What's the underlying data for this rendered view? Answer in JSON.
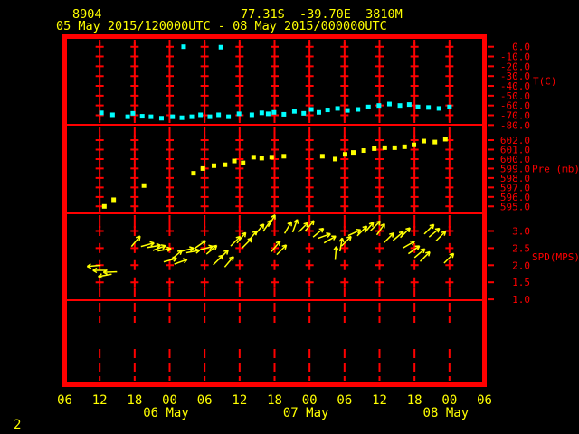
{
  "header": {
    "station_id": "8904",
    "location": "77.31S  -39.70E  3810M",
    "period": "05 May 2015/120000UTC - 08 May 2015/000000UTC"
  },
  "page_number": "2",
  "colors": {
    "background": "#000000",
    "grid": "#ff0000",
    "axis_text": "#ff0000",
    "text": "#ffff00",
    "temperature": "#00ffff",
    "pressure": "#ffff00",
    "wind": "#ffff00"
  },
  "chart_data": {
    "type": "scatter",
    "title": "Buoy 8904 time series 05 May 2015 12UTC - 08 May 2015 00UTC",
    "x_axis": {
      "tick_labels": [
        "06",
        "12",
        "18",
        "00",
        "06",
        "12",
        "18",
        "00",
        "06",
        "12",
        "18",
        "00",
        "06"
      ],
      "tick_interval_hours": 6,
      "hours_span": 72,
      "date_labels": [
        {
          "label": "06 May",
          "tick_index": 3
        },
        {
          "label": "07 May",
          "tick_index": 7
        },
        {
          "label": "08 May",
          "tick_index": 11
        }
      ]
    },
    "panels": [
      {
        "name": "temperature",
        "axis_label": "T(C)",
        "unit": "C",
        "level_labels": [
          "0.0",
          "-10.0",
          "-20.0",
          "-30.0",
          "-40.0",
          "-50.0",
          "-60.0",
          "-70.0",
          "-80.0"
        ],
        "value_top": 0,
        "value_step": -10,
        "series": [
          [
            6.3,
            -67.5
          ],
          [
            8.2,
            -69.5
          ],
          [
            10.8,
            -71.5
          ],
          [
            11.7,
            -68
          ],
          [
            13.3,
            -71
          ],
          [
            14.8,
            -71.5
          ],
          [
            16.6,
            -73
          ],
          [
            18.5,
            -71.5
          ],
          [
            20.1,
            -72.5
          ],
          [
            20.4,
            0
          ],
          [
            21.8,
            -71.5
          ],
          [
            23.3,
            -69.5
          ],
          [
            24.9,
            -71.5
          ],
          [
            26.4,
            -69.5
          ],
          [
            26.8,
            -0.5
          ],
          [
            28.1,
            -71.5
          ],
          [
            29.9,
            -68.5
          ],
          [
            32.1,
            -69.5
          ],
          [
            33.8,
            -67.5
          ],
          [
            34.9,
            -68.5
          ],
          [
            35.9,
            -67
          ],
          [
            37.6,
            -69
          ],
          [
            39.4,
            -66
          ],
          [
            41,
            -68
          ],
          [
            42.3,
            -64
          ],
          [
            43.6,
            -67
          ],
          [
            45.1,
            -64.5
          ],
          [
            46.8,
            -63
          ],
          [
            48.5,
            -65
          ],
          [
            50.3,
            -64
          ],
          [
            52.1,
            -61.5
          ],
          [
            53.9,
            -60
          ],
          [
            55.7,
            -58.5
          ],
          [
            57.5,
            -60
          ],
          [
            59.1,
            -59
          ],
          [
            60.6,
            -61.5
          ],
          [
            62.4,
            -62
          ],
          [
            64.2,
            -63
          ],
          [
            66,
            -61.5
          ]
        ]
      },
      {
        "name": "pressure",
        "axis_label": "Pre (mb)",
        "unit": "mb",
        "level_labels": [
          "602.0",
          "601.0",
          "600.0",
          "599.0",
          "598.0",
          "597.0",
          "596.0",
          "595.0"
        ],
        "value_top": 602,
        "value_step": -1,
        "series": [
          [
            6.8,
            595.0
          ],
          [
            8.4,
            595.7
          ],
          [
            13.6,
            597.2
          ],
          [
            22.1,
            598.5
          ],
          [
            23.7,
            599.0
          ],
          [
            25.6,
            599.3
          ],
          [
            27.5,
            599.4
          ],
          [
            29.1,
            599.8
          ],
          [
            30.6,
            599.6
          ],
          [
            32.4,
            600.2
          ],
          [
            33.8,
            600.1
          ],
          [
            35.5,
            600.2
          ],
          [
            37.6,
            600.3
          ],
          [
            44.2,
            600.3
          ],
          [
            46.4,
            600.0
          ],
          [
            48.1,
            600.5
          ],
          [
            49.5,
            600.7
          ],
          [
            51.3,
            600.9
          ],
          [
            53.1,
            601.1
          ],
          [
            54.9,
            601.2
          ],
          [
            56.6,
            601.2
          ],
          [
            58.3,
            601.3
          ],
          [
            59.9,
            601.5
          ],
          [
            61.6,
            601.9
          ],
          [
            63.5,
            601.8
          ],
          [
            65.3,
            602.1
          ]
        ]
      },
      {
        "name": "wind_speed",
        "axis_label": "SPD(MPS)",
        "unit": "MPS",
        "level_labels": [
          "3.0",
          "2.5",
          "2.0",
          "1.5",
          "1.0"
        ],
        "value_top": 3.0,
        "value_step": -0.5,
        "arrows": [
          [
            5.0,
            1.98,
            185
          ],
          [
            6.0,
            1.85,
            180
          ],
          [
            6.9,
            1.7,
            190
          ],
          [
            7.8,
            1.8,
            182
          ],
          [
            12.2,
            2.7,
            50
          ],
          [
            14.2,
            2.6,
            15
          ],
          [
            15.3,
            2.55,
            10
          ],
          [
            16.2,
            2.5,
            20
          ],
          [
            17.1,
            2.45,
            10
          ],
          [
            18.1,
            2.15,
            15
          ],
          [
            19.2,
            2.3,
            40
          ],
          [
            19.9,
            2.1,
            20
          ],
          [
            21.0,
            2.45,
            15
          ],
          [
            22.0,
            2.4,
            10
          ],
          [
            23.2,
            2.6,
            35
          ],
          [
            24.3,
            2.5,
            15
          ],
          [
            25.2,
            2.45,
            40
          ],
          [
            26.3,
            2.15,
            45
          ],
          [
            27.2,
            2.3,
            45
          ],
          [
            28.2,
            2.1,
            50
          ],
          [
            29.3,
            2.7,
            45
          ],
          [
            30.3,
            2.8,
            50
          ],
          [
            31.3,
            2.65,
            45
          ],
          [
            32.2,
            2.85,
            50
          ],
          [
            33.4,
            3.05,
            50
          ],
          [
            34.7,
            3.15,
            55
          ],
          [
            35.5,
            3.3,
            60
          ],
          [
            36.2,
            2.55,
            50
          ],
          [
            37.2,
            2.45,
            45
          ],
          [
            38.3,
            3.1,
            60
          ],
          [
            39.5,
            3.15,
            70
          ],
          [
            40.9,
            3.1,
            45
          ],
          [
            42.0,
            3.15,
            50
          ],
          [
            43.5,
            2.95,
            40
          ],
          [
            44.5,
            2.85,
            20
          ],
          [
            45.5,
            2.75,
            30
          ],
          [
            46.5,
            2.35,
            85
          ],
          [
            47.4,
            2.6,
            80
          ],
          [
            48.3,
            2.7,
            45
          ],
          [
            49.7,
            2.95,
            25
          ],
          [
            51.0,
            3.0,
            45
          ],
          [
            52.2,
            3.1,
            50
          ],
          [
            53.3,
            3.15,
            45
          ],
          [
            54.2,
            3.05,
            55
          ],
          [
            55.6,
            2.8,
            45
          ],
          [
            57.2,
            2.85,
            40
          ],
          [
            58.4,
            2.95,
            45
          ],
          [
            59.0,
            2.6,
            30
          ],
          [
            59.9,
            2.45,
            35
          ],
          [
            60.9,
            2.35,
            40
          ],
          [
            61.8,
            2.25,
            45
          ],
          [
            62.5,
            3.05,
            45
          ],
          [
            63.4,
            2.95,
            40
          ],
          [
            64.5,
            2.85,
            45
          ],
          [
            65.9,
            2.2,
            45
          ]
        ]
      }
    ]
  }
}
